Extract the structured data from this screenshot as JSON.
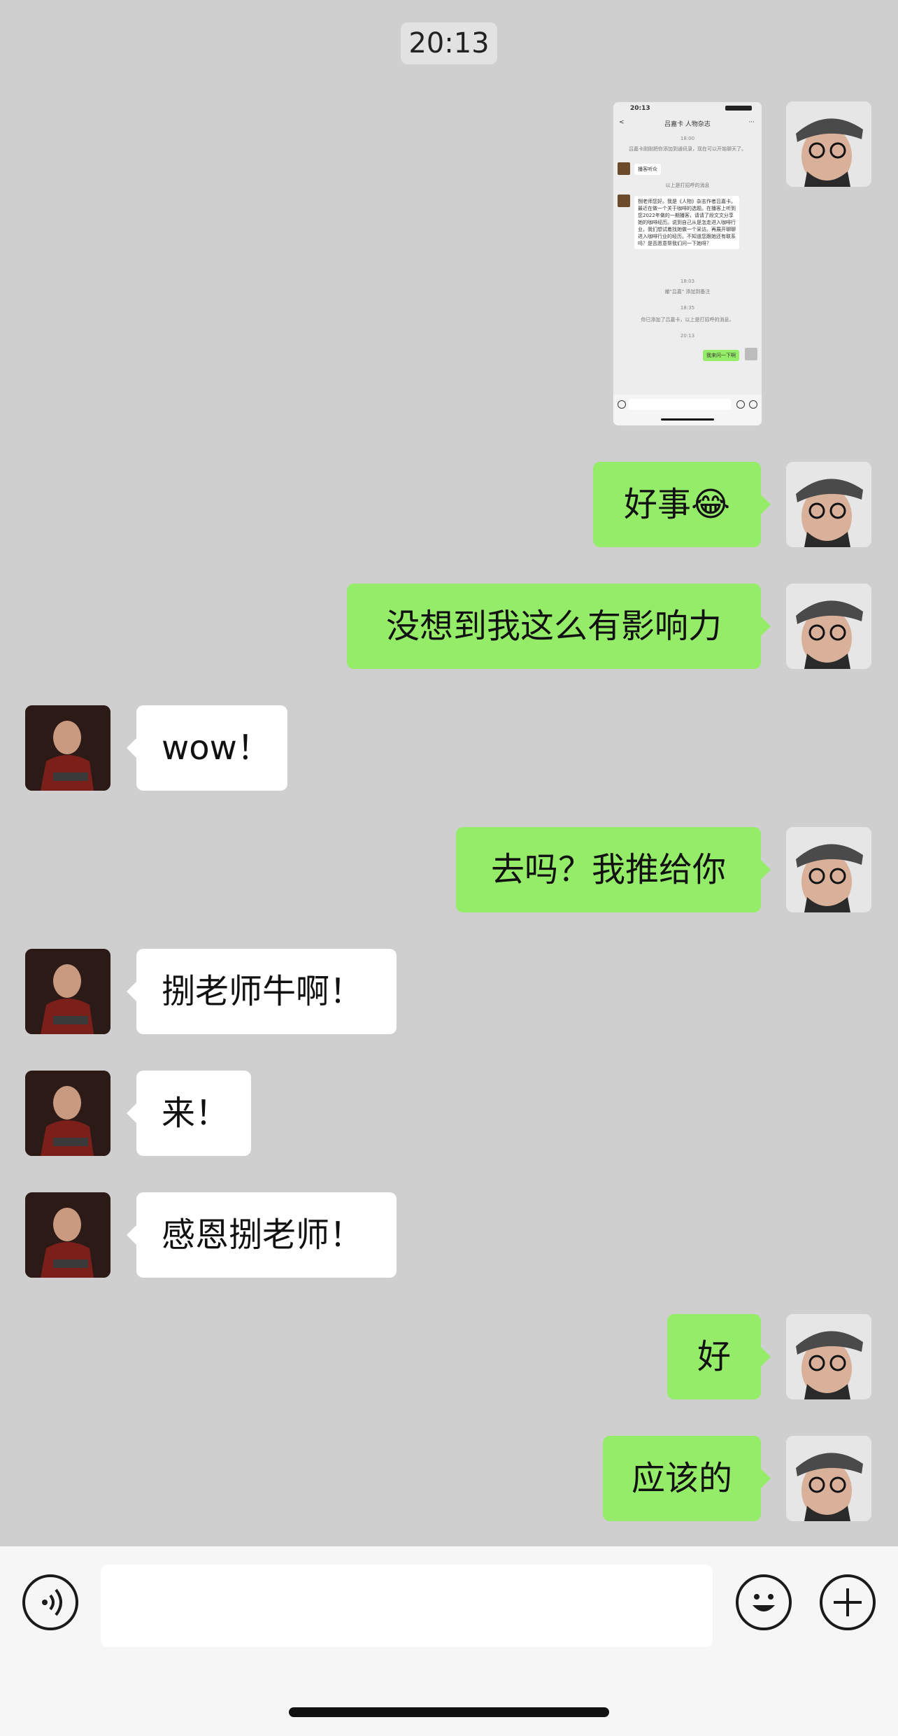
{
  "timestamp": "20:13",
  "colors": {
    "background": "#cfcfcf",
    "outgoing_bubble": "#95ec69",
    "incoming_bubble": "#ffffff",
    "input_bar": "#f6f6f6"
  },
  "messages": [
    {
      "id": "m1",
      "side": "outgoing",
      "type": "image",
      "description": "screenshot-thumbnail"
    },
    {
      "id": "m2",
      "side": "outgoing",
      "type": "text",
      "text": "好事😂"
    },
    {
      "id": "m3",
      "side": "outgoing",
      "type": "text",
      "text": "没想到我这么有影响力"
    },
    {
      "id": "m4",
      "side": "incoming",
      "type": "text",
      "text": "wow！"
    },
    {
      "id": "m5",
      "side": "outgoing",
      "type": "text",
      "text": "去吗？我推给你"
    },
    {
      "id": "m6",
      "side": "incoming",
      "type": "text",
      "text": "捌老师牛啊！"
    },
    {
      "id": "m7",
      "side": "incoming",
      "type": "text",
      "text": "来！"
    },
    {
      "id": "m8",
      "side": "incoming",
      "type": "text",
      "text": "感恩捌老师！"
    },
    {
      "id": "m9",
      "side": "outgoing",
      "type": "text",
      "text": "好"
    },
    {
      "id": "m10",
      "side": "outgoing",
      "type": "text",
      "text": "应该的"
    }
  ],
  "thumbnail": {
    "status_time": "20:13",
    "title": "吕嘉卡 人物杂志",
    "stamp_1": "18:00",
    "sys_1": "吕嘉卡刚刚把你添加到通讯录，现在可以开始聊天了。",
    "msg_1": "播客听众",
    "sys_2": "以上是打招呼的消息",
    "msg_long": "捌老师您好。我是《人物》杂志作者吕嘉卡。最近在做一个关于咖啡的选题。在播客上听到您2022年做的一期播客，请请了段文文分享她的咖啡经历。说到自己从是怎走进入咖啡行业，我们想试着找她做一个采访。再展开聊聊进入咖啡行业的经历。不知道您跟她还有联系吗？是否愿意帮我们问一下她呀？",
    "stamp_2": "18:03",
    "sys_3": "撤\"吕嘉\" 添加到备注",
    "stamp_3": "18:35",
    "sys_4": "你已添加了吕嘉卡，以上是打招呼的消息。",
    "stamp_4": "20:13",
    "msg_green": "我来问一下啊"
  },
  "input": {
    "voice_icon": "voice-icon",
    "emoji_icon": "emoji-icon",
    "plus_icon": "plus-icon",
    "placeholder": ""
  }
}
